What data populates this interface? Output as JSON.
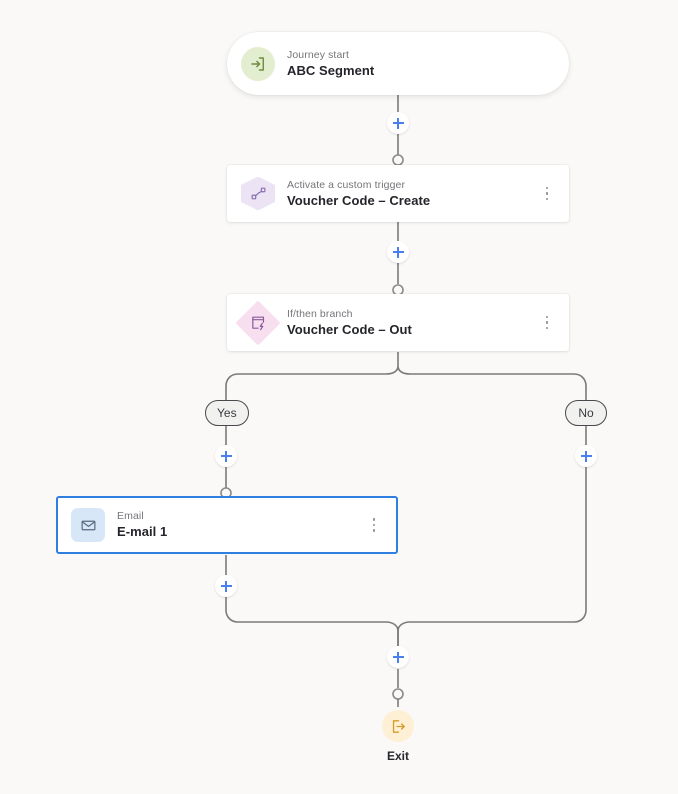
{
  "canvas": {
    "background_color": "#faf9f7",
    "accent_color": "#4a7ff0",
    "selection_color": "#2f7fe0",
    "connector_color": "#7a7a7a"
  },
  "nodes": [
    {
      "id": "journey-start",
      "subtitle": "Journey start",
      "title": "ABC Segment",
      "icon": "sign-in-icon",
      "icon_shape": "circle",
      "icon_bg": "#e3edcf",
      "icon_color": "#6f8c3f",
      "has_menu": false,
      "selected": false
    },
    {
      "id": "custom-trigger",
      "subtitle": "Activate a custom trigger",
      "title": "Voucher Code – Create",
      "icon": "custom-trigger-icon",
      "icon_shape": "hexagon",
      "icon_bg": "#ece4f5",
      "icon_color": "#8a6fb0",
      "has_menu": true,
      "selected": false
    },
    {
      "id": "if-then-branch",
      "subtitle": "If/then branch",
      "title": "Voucher Code – Out",
      "icon": "if-then-branch-icon",
      "icon_shape": "diamond",
      "icon_bg": "#f8dff0",
      "icon_color": "#8a5a9e",
      "has_menu": true,
      "selected": false
    },
    {
      "id": "email-1",
      "subtitle": "Email",
      "title": "E-mail 1",
      "icon": "envelope-icon",
      "icon_shape": "rounded-square",
      "icon_bg": "#d7e7f8",
      "icon_color": "#5a6b80",
      "has_menu": true,
      "selected": true
    }
  ],
  "branch_labels": {
    "yes": "Yes",
    "no": "No"
  },
  "add_buttons": [
    {
      "id": "add-after-start",
      "label": "+"
    },
    {
      "id": "add-after-trigger",
      "label": "+"
    },
    {
      "id": "add-yes-branch",
      "label": "+"
    },
    {
      "id": "add-no-branch",
      "label": "+"
    },
    {
      "id": "add-after-email",
      "label": "+"
    },
    {
      "id": "add-before-exit",
      "label": "+"
    }
  ],
  "exit": {
    "label": "Exit",
    "icon": "sign-out-icon",
    "icon_bg": "#fdf0d5",
    "icon_color": "#d89a28"
  }
}
